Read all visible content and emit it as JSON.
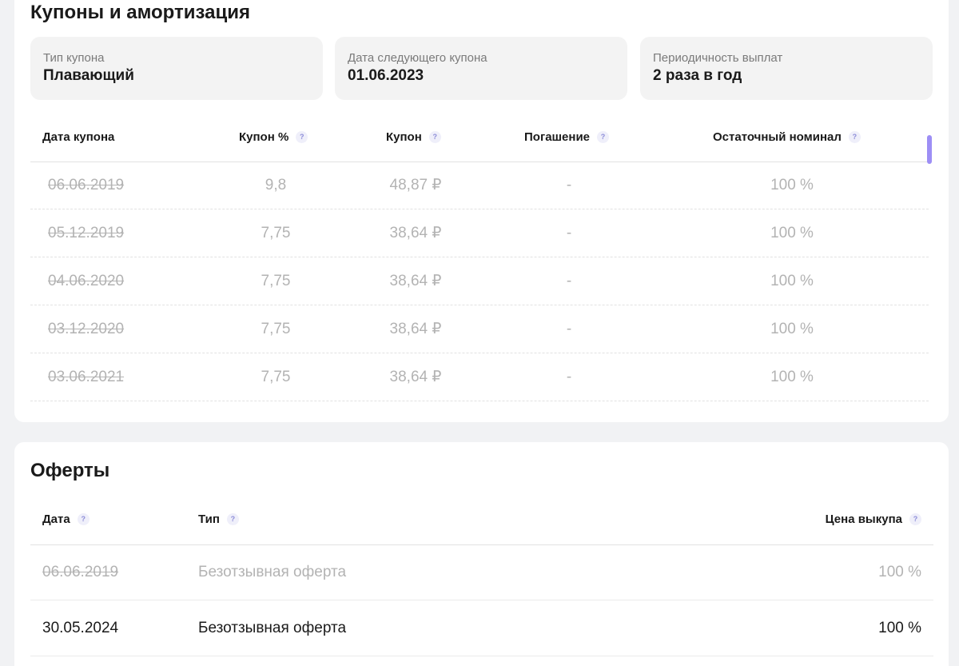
{
  "coupons": {
    "title": "Купоны и амортизация",
    "info": [
      {
        "label": "Тип купона",
        "value": "Плавающий"
      },
      {
        "label": "Дата следующего купона",
        "value": "01.06.2023"
      },
      {
        "label": "Периодичность выплат",
        "value": "2 раза в год"
      }
    ],
    "columns": {
      "date": "Дата купона",
      "rate": "Купон %",
      "coupon": "Купон",
      "repayment": "Погашение",
      "nominal": "Остаточный номинал"
    },
    "help_glyph": "?",
    "rows": [
      {
        "date": "06.06.2019",
        "rate": "9,8",
        "coupon": "48,87 ₽",
        "repayment": "-",
        "nominal": "100 %"
      },
      {
        "date": "05.12.2019",
        "rate": "7,75",
        "coupon": "38,64 ₽",
        "repayment": "-",
        "nominal": "100 %"
      },
      {
        "date": "04.06.2020",
        "rate": "7,75",
        "coupon": "38,64 ₽",
        "repayment": "-",
        "nominal": "100 %"
      },
      {
        "date": "03.12.2020",
        "rate": "7,75",
        "coupon": "38,64 ₽",
        "repayment": "-",
        "nominal": "100 %"
      },
      {
        "date": "03.06.2021",
        "rate": "7,75",
        "coupon": "38,64 ₽",
        "repayment": "-",
        "nominal": "100 %"
      }
    ],
    "scroll_position": 0
  },
  "offers": {
    "title": "Оферты",
    "columns": {
      "date": "Дата",
      "type": "Тип",
      "price": "Цена выкупа"
    },
    "rows": [
      {
        "date": "06.06.2019",
        "type": "Безотзывная оферта",
        "price": "100 %",
        "past": true
      },
      {
        "date": "30.05.2024",
        "type": "Безотзывная оферта",
        "price": "100 %",
        "past": false
      }
    ]
  },
  "colors": {
    "accent": "#9d8ef5",
    "muted_text": "#b3b3b3",
    "card_bg": "#ffffff",
    "page_bg": "#f1f2f4"
  }
}
